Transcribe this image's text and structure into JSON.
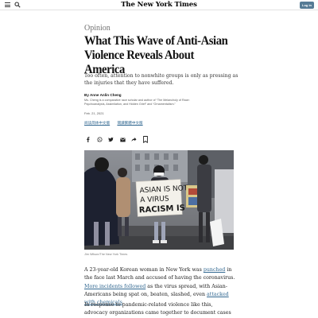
{
  "header": {
    "masthead": "The New York Times",
    "login_label": "Log in"
  },
  "icons": [
    "menu-icon",
    "search-icon",
    "facebook-icon",
    "whatsapp-icon",
    "twitter-icon",
    "email-icon",
    "share-icon",
    "bookmark-icon"
  ],
  "article": {
    "section": "Opinion",
    "headline": "What This Wave of Anti-Asian Violence Reveals About America",
    "summary": "Too often, attention to nonwhite groups is only as pressing as the injuries that they have suffered.",
    "byline": "By Anne Anlin Cheng",
    "author_bio": "Ms. Cheng is a comparative race scholar and author of “The Melancholy of Race: Psychoanalysis, Assimilation, and Hidden Grief” and “Ornamentalism.”",
    "date": "Feb. 21, 2021",
    "lang_links": [
      "阅读简体中文版",
      "閱讀繁體中文版"
    ]
  },
  "hero": {
    "sign_lines": [
      "ASIAN IS NOT",
      "A VIRUS",
      "RACISM IS"
    ],
    "caption": "Jim Wilson/The New York Times"
  },
  "body": {
    "p1": {
      "t1": "A 23-year-old Korean woman in New York was ",
      "l1": "punched",
      "t2": " in the face last March and accused of having the coronavirus. ",
      "l2": "More incidents followed",
      "t3": " as the virus spread, with Asian-Americans being spat on, beaten, slashed, even ",
      "l3": "attacked with chemicals",
      "t4": "."
    },
    "p2": "In response to pandemic-related violence like this, advocacy organizations came together to document cases of harassment and"
  },
  "colors": {
    "accent_link": "#326891",
    "login_bg": "#567b95",
    "section_gray": "#727272"
  }
}
